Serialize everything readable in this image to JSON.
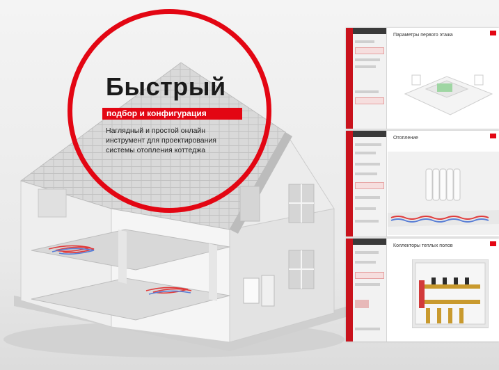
{
  "hero": {
    "headline": "Быстрый",
    "tagline": "подбор и конфигурация",
    "description": "Наглядный и простой онлайн инструмент для проектирования системы отопления коттеджа"
  },
  "screenshots": [
    {
      "title": "Параметры первого этажа"
    },
    {
      "title": "Отопление"
    },
    {
      "title": "Коллекторы теплых полов"
    }
  ],
  "colors": {
    "accent": "#e30613",
    "text": "#1a1a1a"
  }
}
